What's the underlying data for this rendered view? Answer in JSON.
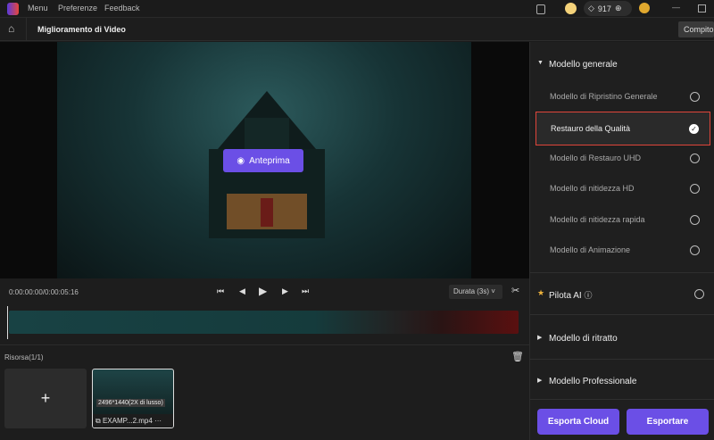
{
  "titlebar": {
    "menu": "Menu",
    "preferences": "Preferenze",
    "feedback": "Feedback",
    "credits": "917"
  },
  "toolbar": {
    "title": "Miglioramento di Video",
    "task": "Compito"
  },
  "preview": {
    "button": "Anteprima"
  },
  "controls": {
    "time": "0:00:00:00/0:00:05:16",
    "duration": "Durata (3s)"
  },
  "resources": {
    "label": "Risorsa(1/1)",
    "add": "+",
    "clip": {
      "resolution": "2496*1440(2X di lusso)",
      "name": "EXAMP...2.mp4",
      "more": "···"
    }
  },
  "panel": {
    "general": {
      "title": "Modello generale",
      "items": [
        {
          "label": "Modello di Ripristino Generale",
          "selected": false
        },
        {
          "label": "Restauro della Qualità",
          "selected": true
        },
        {
          "label": "Modello di Restauro UHD",
          "selected": false
        },
        {
          "label": "Modello di nitidezza HD",
          "selected": false
        },
        {
          "label": "Modello di nitidezza rapida",
          "selected": false
        },
        {
          "label": "Modello di Animazione",
          "selected": false
        }
      ]
    },
    "pilot": "Pilota AI",
    "portrait": "Modello di ritratto",
    "professional": "Modello Professionale",
    "export_cloud": "Esporta Cloud",
    "export": "Esportare"
  },
  "colors": {
    "accent": "#6b4fe6",
    "highlight": "#e0453a"
  }
}
